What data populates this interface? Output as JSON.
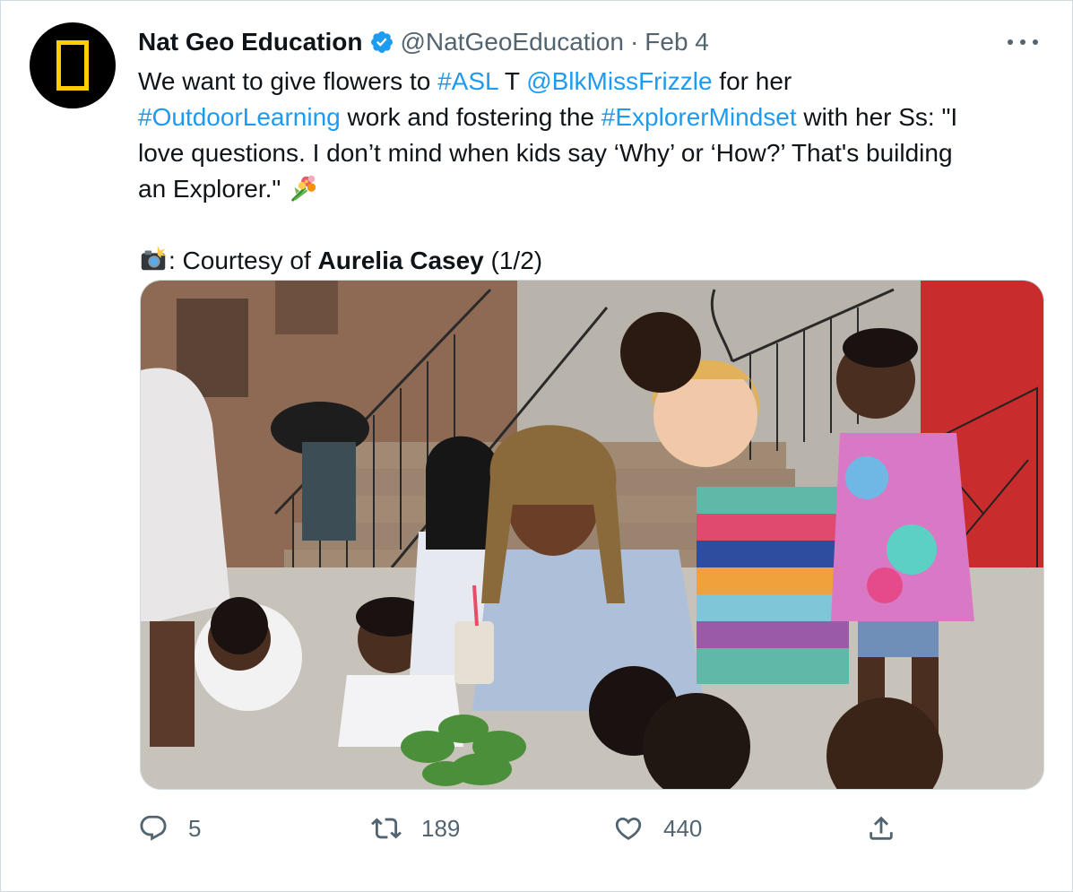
{
  "tweet": {
    "author": {
      "display_name": "Nat Geo Education",
      "handle": "@NatGeoEducation",
      "separator": "·",
      "date": "Feb 4",
      "verified": true,
      "avatar_icon": "nat-geo-logo-icon",
      "avatar_colors": {
        "background": "#000000",
        "border": "#ffce00"
      }
    },
    "text": {
      "line1": {
        "part1": "We want to give flowers to ",
        "hashtag_asl": "#ASL",
        "part2": " T ",
        "mention": "@BlkMissFrizzle",
        "part3": " for her"
      },
      "line2": {
        "hashtag_outdoor": "#OutdoorLearning",
        "part1": " work and fostering the ",
        "hashtag_explorer": "#ExplorerMindset",
        "part2": " with her Ss: \"I"
      },
      "line3": "love questions. I don’t mind when kids say ‘Why’ or ‘How?’ That's building",
      "line4": "an Explorer.\" ",
      "bouquet_icon": "bouquet-emoji-icon",
      "credit": {
        "camera_icon": "camera-flash-emoji-icon",
        "prefix": ": Courtesy of ",
        "name": "Aurelia Casey",
        "suffix": " (1/2)"
      }
    },
    "media": {
      "alt": "Teacher crouching outdoors with a group of children around a small plant near a brownstone stoop"
    },
    "actions": {
      "reply_icon": "reply-icon",
      "reply_count": "5",
      "retweet_icon": "retweet-icon",
      "retweet_count": "189",
      "like_icon": "heart-icon",
      "like_count": "440",
      "share_icon": "share-icon"
    },
    "more_icon": "more-options-icon",
    "colors": {
      "link": "#1d9bf0",
      "secondary_text": "#536471",
      "primary_text": "#0f1419",
      "border": "#cfd9de"
    }
  }
}
